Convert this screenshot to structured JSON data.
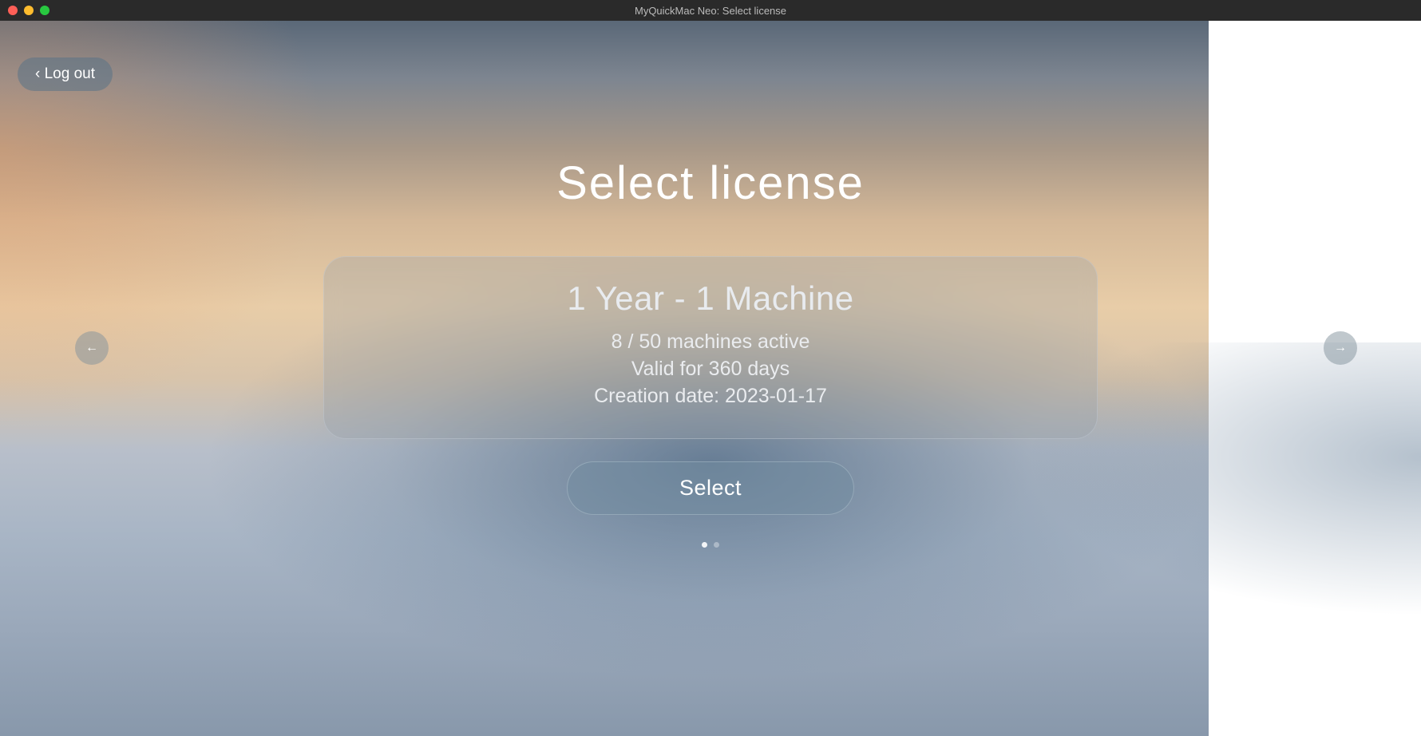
{
  "window": {
    "title": "MyQuickMac Neo: Select license"
  },
  "header": {
    "logout_label": "‹ Log out"
  },
  "page": {
    "title": "Select license"
  },
  "nav": {
    "prev_symbol": "←",
    "next_symbol": "→"
  },
  "license": {
    "title": "1 Year - 1 Machine",
    "machines_active": "8 / 50 machines active",
    "validity": "Valid for 360 days",
    "creation_date": "Creation date: 2023-01-17"
  },
  "actions": {
    "select_label": "Select"
  },
  "pagination": {
    "current_index": 0,
    "total": 2
  }
}
